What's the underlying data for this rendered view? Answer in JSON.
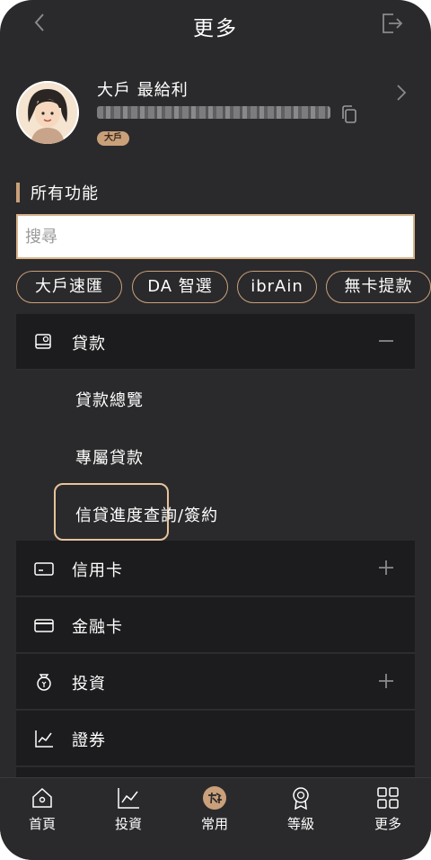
{
  "header": {
    "title": "更多"
  },
  "profile": {
    "name": "大戶 最給利",
    "tier": "大戶"
  },
  "section": {
    "title": "所有功能"
  },
  "search": {
    "placeholder": "搜尋",
    "value": ""
  },
  "chips": [
    "大戶速匯",
    "DA 智選",
    "ibrAin",
    "無卡提款"
  ],
  "menu": {
    "loan": {
      "label": "貸款",
      "expanded": true,
      "toggle": "minus-icon",
      "sub_items": [
        "貸款總覽",
        "專屬貸款",
        "信貸進度查詢/簽約"
      ],
      "highlighted": "專屬貸款"
    },
    "credit": {
      "label": "信用卡",
      "toggle": "plus-icon"
    },
    "debit": {
      "label": "金融卡"
    },
    "invest": {
      "label": "投資",
      "toggle": "plus-icon"
    },
    "securities": {
      "label": "證券"
    }
  },
  "tabs": [
    {
      "label": "首頁",
      "icon": "home-icon"
    },
    {
      "label": "投資",
      "icon": "chart-icon"
    },
    {
      "label": "常用",
      "icon": "dawho-logo-icon"
    },
    {
      "label": "等級",
      "icon": "medal-icon"
    },
    {
      "label": "更多",
      "icon": "grid-icon"
    }
  ],
  "colors": {
    "background": "#2a2a2c",
    "card": "#1c1c1e",
    "accent": "#c9a07a",
    "text": "#ffffff"
  }
}
